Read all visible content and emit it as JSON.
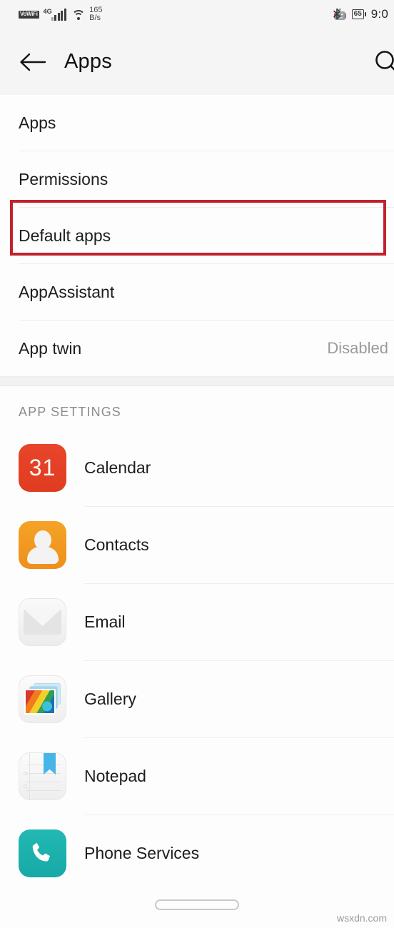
{
  "status_bar": {
    "vowifi_label": "VoWiFi",
    "network_type": "4G",
    "data_rate_value": "165",
    "data_rate_unit": "B/s",
    "bluetooth_icon": "bluetooth-icon",
    "battery_level": "65",
    "time": "9:0"
  },
  "app_bar": {
    "back_icon": "back-arrow-icon",
    "title": "Apps",
    "search_icon": "search-icon"
  },
  "settings_rows": [
    {
      "label": "Apps",
      "value": ""
    },
    {
      "label": "Permissions",
      "value": ""
    },
    {
      "label": "Default apps",
      "value": ""
    },
    {
      "label": "AppAssistant",
      "value": ""
    },
    {
      "label": "App twin",
      "value": "Disabled"
    }
  ],
  "section": {
    "header": "APP SETTINGS"
  },
  "app_settings_rows": [
    {
      "name": "Calendar",
      "icon": "calendar-icon",
      "icon_text": "31",
      "icon_color": "#e3421f"
    },
    {
      "name": "Contacts",
      "icon": "contacts-icon",
      "icon_color": "#f09a1f"
    },
    {
      "name": "Email",
      "icon": "email-icon",
      "icon_color": "#ededed"
    },
    {
      "name": "Gallery",
      "icon": "gallery-icon",
      "icon_color": "#f2f2f2"
    },
    {
      "name": "Notepad",
      "icon": "notepad-icon",
      "icon_color": "#f2f2f2"
    },
    {
      "name": "Phone Services",
      "icon": "phone-icon",
      "icon_color": "#19aca9"
    }
  ],
  "annotation": {
    "type": "highlight-box",
    "target": "Default apps",
    "color": "#c2222c"
  },
  "bottom": {
    "gesture_bar": "home-gesture-pill",
    "watermark": "wsxdn.com"
  }
}
